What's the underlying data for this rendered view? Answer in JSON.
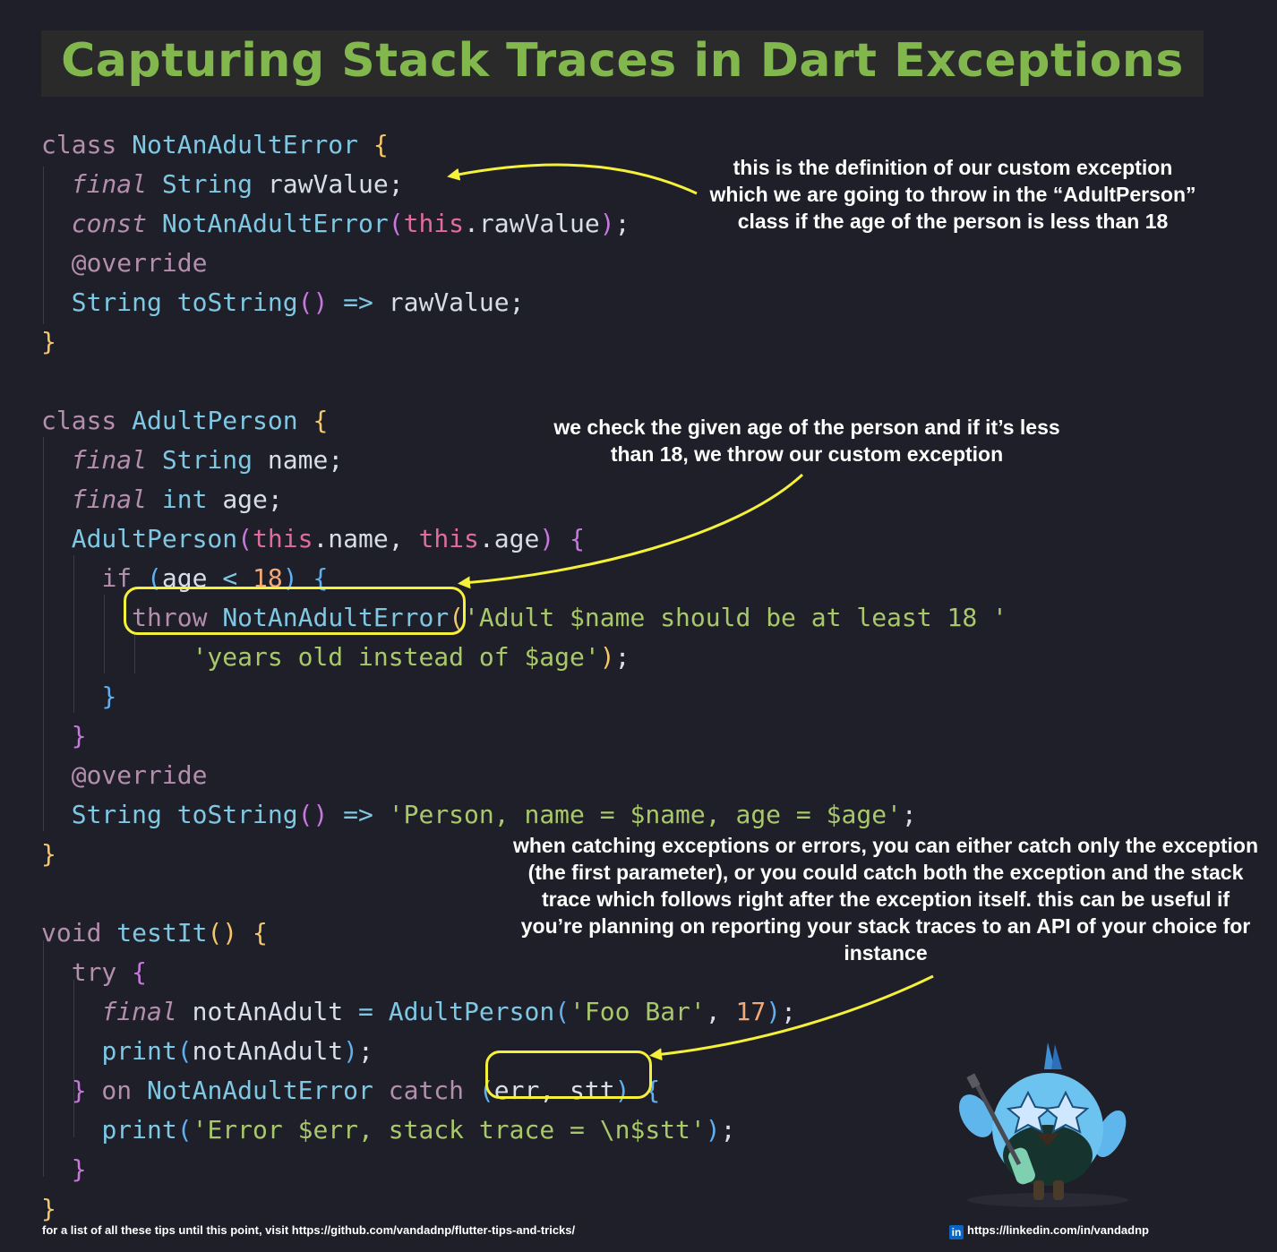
{
  "title": "Capturing Stack Traces in Dart Exceptions",
  "code_lines": [
    [
      [
        "kw",
        "class "
      ],
      [
        "ty",
        "NotAnAdultError "
      ],
      [
        "b1",
        "{"
      ]
    ],
    [
      [
        "pl",
        "  "
      ],
      [
        "it",
        "final "
      ],
      [
        "ty",
        "String "
      ],
      [
        "pl",
        "rawValue;"
      ]
    ],
    [
      [
        "pl",
        "  "
      ],
      [
        "it",
        "const "
      ],
      [
        "fn",
        "NotAnAdultError"
      ],
      [
        "b2",
        "("
      ],
      [
        "th",
        "this"
      ],
      [
        "pl",
        ".rawValue"
      ],
      [
        "b2",
        ")"
      ],
      [
        "pl",
        ";"
      ]
    ],
    [
      [
        "pl",
        "  "
      ],
      [
        "an",
        "@override"
      ]
    ],
    [
      [
        "pl",
        "  "
      ],
      [
        "ty",
        "String "
      ],
      [
        "fn",
        "toString"
      ],
      [
        "b2",
        "()"
      ],
      [
        "op",
        " => "
      ],
      [
        "pl",
        "rawValue;"
      ]
    ],
    [
      [
        "b1",
        "}"
      ]
    ],
    [],
    [
      [
        "kw",
        "class "
      ],
      [
        "ty",
        "AdultPerson "
      ],
      [
        "b1",
        "{"
      ]
    ],
    [
      [
        "pl",
        "  "
      ],
      [
        "it",
        "final "
      ],
      [
        "ty",
        "String "
      ],
      [
        "pl",
        "name;"
      ]
    ],
    [
      [
        "pl",
        "  "
      ],
      [
        "it",
        "final "
      ],
      [
        "ty",
        "int "
      ],
      [
        "pl",
        "age;"
      ]
    ],
    [
      [
        "pl",
        "  "
      ],
      [
        "fn",
        "AdultPerson"
      ],
      [
        "b2",
        "("
      ],
      [
        "th",
        "this"
      ],
      [
        "pl",
        ".name, "
      ],
      [
        "th",
        "this"
      ],
      [
        "pl",
        ".age"
      ],
      [
        "b2",
        ")"
      ],
      [
        "pl",
        " "
      ],
      [
        "b2",
        "{"
      ]
    ],
    [
      [
        "pl",
        "    "
      ],
      [
        "kw",
        "if "
      ],
      [
        "b3",
        "("
      ],
      [
        "pl",
        "age "
      ],
      [
        "op",
        "<"
      ],
      [
        "pl",
        " "
      ],
      [
        "nm",
        "18"
      ],
      [
        "b3",
        ")"
      ],
      [
        "pl",
        " "
      ],
      [
        "b3",
        "{"
      ]
    ],
    [
      [
        "pl",
        "      "
      ],
      [
        "kw",
        "throw "
      ],
      [
        "fn",
        "NotAnAdultError"
      ],
      [
        "b1",
        "("
      ],
      [
        "st",
        "'Adult $name should be at least 18 '"
      ]
    ],
    [
      [
        "pl",
        "          "
      ],
      [
        "st",
        "'years old instead of $age'"
      ],
      [
        "b1",
        ")"
      ],
      [
        "pl",
        ";"
      ]
    ],
    [
      [
        "pl",
        "    "
      ],
      [
        "b3",
        "}"
      ]
    ],
    [
      [
        "pl",
        "  "
      ],
      [
        "b2",
        "}"
      ]
    ],
    [
      [
        "pl",
        "  "
      ],
      [
        "an",
        "@override"
      ]
    ],
    [
      [
        "pl",
        "  "
      ],
      [
        "ty",
        "String "
      ],
      [
        "fn",
        "toString"
      ],
      [
        "b2",
        "()"
      ],
      [
        "op",
        " => "
      ],
      [
        "st",
        "'Person, name = $name, age = $age'"
      ],
      [
        "pl",
        ";"
      ]
    ],
    [
      [
        "b1",
        "}"
      ]
    ],
    [],
    [
      [
        "kw",
        "void "
      ],
      [
        "fn",
        "testIt"
      ],
      [
        "b1",
        "()"
      ],
      [
        "pl",
        " "
      ],
      [
        "b1",
        "{"
      ]
    ],
    [
      [
        "pl",
        "  "
      ],
      [
        "kw",
        "try "
      ],
      [
        "b2",
        "{"
      ]
    ],
    [
      [
        "pl",
        "    "
      ],
      [
        "it",
        "final "
      ],
      [
        "pl",
        "notAnAdult "
      ],
      [
        "op",
        "="
      ],
      [
        "pl",
        " "
      ],
      [
        "fn",
        "AdultPerson"
      ],
      [
        "b3",
        "("
      ],
      [
        "st",
        "'Foo Bar'"
      ],
      [
        "pl",
        ", "
      ],
      [
        "nm",
        "17"
      ],
      [
        "b3",
        ")"
      ],
      [
        "pl",
        ";"
      ]
    ],
    [
      [
        "pl",
        "    "
      ],
      [
        "fn",
        "print"
      ],
      [
        "b3",
        "("
      ],
      [
        "pl",
        "notAnAdult"
      ],
      [
        "b3",
        ")"
      ],
      [
        "pl",
        ";"
      ]
    ],
    [
      [
        "pl",
        "  "
      ],
      [
        "b2",
        "}"
      ],
      [
        "kw",
        " on "
      ],
      [
        "ty",
        "NotAnAdultError "
      ],
      [
        "kw",
        "catch "
      ],
      [
        "b3",
        "("
      ],
      [
        "pl",
        "err, stt"
      ],
      [
        "b3",
        ")"
      ],
      [
        "pl",
        " "
      ],
      [
        "b3",
        "{"
      ]
    ],
    [
      [
        "pl",
        "    "
      ],
      [
        "fn",
        "print"
      ],
      [
        "b3",
        "("
      ],
      [
        "st",
        "'Error $err, stack trace = \\n$stt'"
      ],
      [
        "b3",
        ")"
      ],
      [
        "pl",
        ";"
      ]
    ],
    [
      [
        "pl",
        "  "
      ],
      [
        "b2",
        "}"
      ]
    ],
    [
      [
        "b1",
        "}"
      ]
    ]
  ],
  "notes": {
    "note1": "this is the definition of our custom exception which we are going to throw in the “AdultPerson” class if the age of the person is less than 18",
    "note2": "we check the given age of the person and if it’s less than 18, we throw our custom exception",
    "note3": "when catching exceptions or errors, you can either catch only the exception (the first parameter), or you could catch both the exception and the stack trace which follows right after the exception itself. this can be useful if you’re planning on reporting your stack traces to an API of your choice for instance"
  },
  "footer": {
    "left": "for a list of all these tips until this point, visit https://github.com/vandadnp/flutter-tips-and-tricks/",
    "right": "https://linkedin.com/in/vandadnp",
    "badge": "in"
  },
  "colors": {
    "title": "#82b74e",
    "highlight": "#f5f03a",
    "background": "#1f1f29"
  },
  "icons": [
    "linkedin-icon",
    "dart-bird-mascot"
  ]
}
